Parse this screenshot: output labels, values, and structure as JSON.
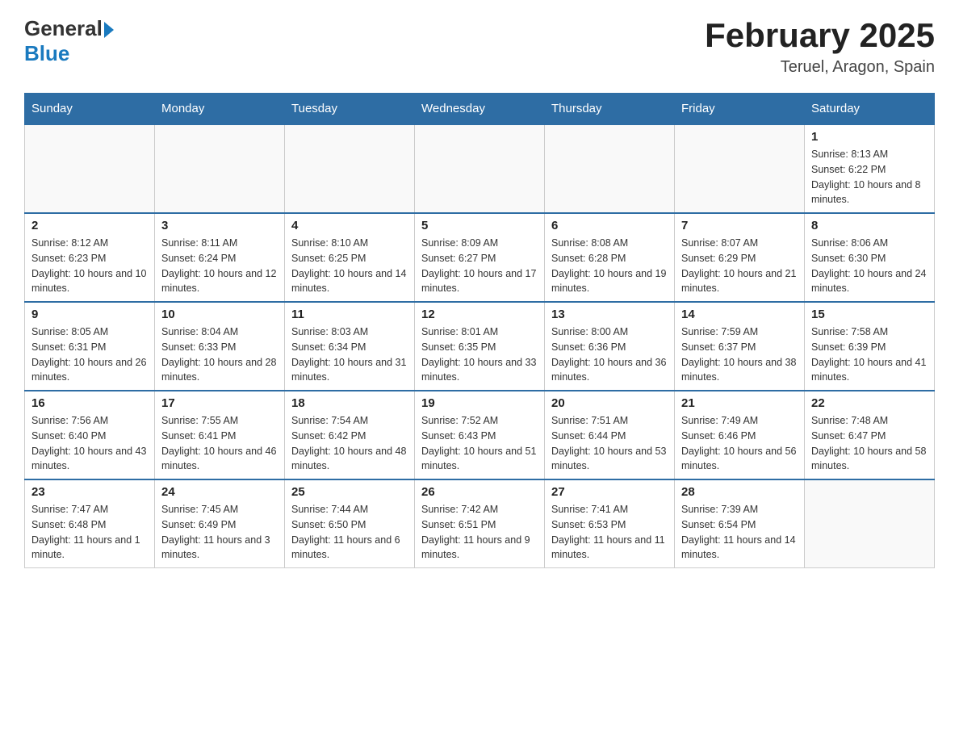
{
  "header": {
    "logo_general": "General",
    "logo_blue": "Blue",
    "month_year": "February 2025",
    "location": "Teruel, Aragon, Spain"
  },
  "weekdays": [
    "Sunday",
    "Monday",
    "Tuesday",
    "Wednesday",
    "Thursday",
    "Friday",
    "Saturday"
  ],
  "weeks": [
    [
      {
        "day": "",
        "sunrise": "",
        "sunset": "",
        "daylight": ""
      },
      {
        "day": "",
        "sunrise": "",
        "sunset": "",
        "daylight": ""
      },
      {
        "day": "",
        "sunrise": "",
        "sunset": "",
        "daylight": ""
      },
      {
        "day": "",
        "sunrise": "",
        "sunset": "",
        "daylight": ""
      },
      {
        "day": "",
        "sunrise": "",
        "sunset": "",
        "daylight": ""
      },
      {
        "day": "",
        "sunrise": "",
        "sunset": "",
        "daylight": ""
      },
      {
        "day": "1",
        "sunrise": "Sunrise: 8:13 AM",
        "sunset": "Sunset: 6:22 PM",
        "daylight": "Daylight: 10 hours and 8 minutes."
      }
    ],
    [
      {
        "day": "2",
        "sunrise": "Sunrise: 8:12 AM",
        "sunset": "Sunset: 6:23 PM",
        "daylight": "Daylight: 10 hours and 10 minutes."
      },
      {
        "day": "3",
        "sunrise": "Sunrise: 8:11 AM",
        "sunset": "Sunset: 6:24 PM",
        "daylight": "Daylight: 10 hours and 12 minutes."
      },
      {
        "day": "4",
        "sunrise": "Sunrise: 8:10 AM",
        "sunset": "Sunset: 6:25 PM",
        "daylight": "Daylight: 10 hours and 14 minutes."
      },
      {
        "day": "5",
        "sunrise": "Sunrise: 8:09 AM",
        "sunset": "Sunset: 6:27 PM",
        "daylight": "Daylight: 10 hours and 17 minutes."
      },
      {
        "day": "6",
        "sunrise": "Sunrise: 8:08 AM",
        "sunset": "Sunset: 6:28 PM",
        "daylight": "Daylight: 10 hours and 19 minutes."
      },
      {
        "day": "7",
        "sunrise": "Sunrise: 8:07 AM",
        "sunset": "Sunset: 6:29 PM",
        "daylight": "Daylight: 10 hours and 21 minutes."
      },
      {
        "day": "8",
        "sunrise": "Sunrise: 8:06 AM",
        "sunset": "Sunset: 6:30 PM",
        "daylight": "Daylight: 10 hours and 24 minutes."
      }
    ],
    [
      {
        "day": "9",
        "sunrise": "Sunrise: 8:05 AM",
        "sunset": "Sunset: 6:31 PM",
        "daylight": "Daylight: 10 hours and 26 minutes."
      },
      {
        "day": "10",
        "sunrise": "Sunrise: 8:04 AM",
        "sunset": "Sunset: 6:33 PM",
        "daylight": "Daylight: 10 hours and 28 minutes."
      },
      {
        "day": "11",
        "sunrise": "Sunrise: 8:03 AM",
        "sunset": "Sunset: 6:34 PM",
        "daylight": "Daylight: 10 hours and 31 minutes."
      },
      {
        "day": "12",
        "sunrise": "Sunrise: 8:01 AM",
        "sunset": "Sunset: 6:35 PM",
        "daylight": "Daylight: 10 hours and 33 minutes."
      },
      {
        "day": "13",
        "sunrise": "Sunrise: 8:00 AM",
        "sunset": "Sunset: 6:36 PM",
        "daylight": "Daylight: 10 hours and 36 minutes."
      },
      {
        "day": "14",
        "sunrise": "Sunrise: 7:59 AM",
        "sunset": "Sunset: 6:37 PM",
        "daylight": "Daylight: 10 hours and 38 minutes."
      },
      {
        "day": "15",
        "sunrise": "Sunrise: 7:58 AM",
        "sunset": "Sunset: 6:39 PM",
        "daylight": "Daylight: 10 hours and 41 minutes."
      }
    ],
    [
      {
        "day": "16",
        "sunrise": "Sunrise: 7:56 AM",
        "sunset": "Sunset: 6:40 PM",
        "daylight": "Daylight: 10 hours and 43 minutes."
      },
      {
        "day": "17",
        "sunrise": "Sunrise: 7:55 AM",
        "sunset": "Sunset: 6:41 PM",
        "daylight": "Daylight: 10 hours and 46 minutes."
      },
      {
        "day": "18",
        "sunrise": "Sunrise: 7:54 AM",
        "sunset": "Sunset: 6:42 PM",
        "daylight": "Daylight: 10 hours and 48 minutes."
      },
      {
        "day": "19",
        "sunrise": "Sunrise: 7:52 AM",
        "sunset": "Sunset: 6:43 PM",
        "daylight": "Daylight: 10 hours and 51 minutes."
      },
      {
        "day": "20",
        "sunrise": "Sunrise: 7:51 AM",
        "sunset": "Sunset: 6:44 PM",
        "daylight": "Daylight: 10 hours and 53 minutes."
      },
      {
        "day": "21",
        "sunrise": "Sunrise: 7:49 AM",
        "sunset": "Sunset: 6:46 PM",
        "daylight": "Daylight: 10 hours and 56 minutes."
      },
      {
        "day": "22",
        "sunrise": "Sunrise: 7:48 AM",
        "sunset": "Sunset: 6:47 PM",
        "daylight": "Daylight: 10 hours and 58 minutes."
      }
    ],
    [
      {
        "day": "23",
        "sunrise": "Sunrise: 7:47 AM",
        "sunset": "Sunset: 6:48 PM",
        "daylight": "Daylight: 11 hours and 1 minute."
      },
      {
        "day": "24",
        "sunrise": "Sunrise: 7:45 AM",
        "sunset": "Sunset: 6:49 PM",
        "daylight": "Daylight: 11 hours and 3 minutes."
      },
      {
        "day": "25",
        "sunrise": "Sunrise: 7:44 AM",
        "sunset": "Sunset: 6:50 PM",
        "daylight": "Daylight: 11 hours and 6 minutes."
      },
      {
        "day": "26",
        "sunrise": "Sunrise: 7:42 AM",
        "sunset": "Sunset: 6:51 PM",
        "daylight": "Daylight: 11 hours and 9 minutes."
      },
      {
        "day": "27",
        "sunrise": "Sunrise: 7:41 AM",
        "sunset": "Sunset: 6:53 PM",
        "daylight": "Daylight: 11 hours and 11 minutes."
      },
      {
        "day": "28",
        "sunrise": "Sunrise: 7:39 AM",
        "sunset": "Sunset: 6:54 PM",
        "daylight": "Daylight: 11 hours and 14 minutes."
      },
      {
        "day": "",
        "sunrise": "",
        "sunset": "",
        "daylight": ""
      }
    ]
  ]
}
